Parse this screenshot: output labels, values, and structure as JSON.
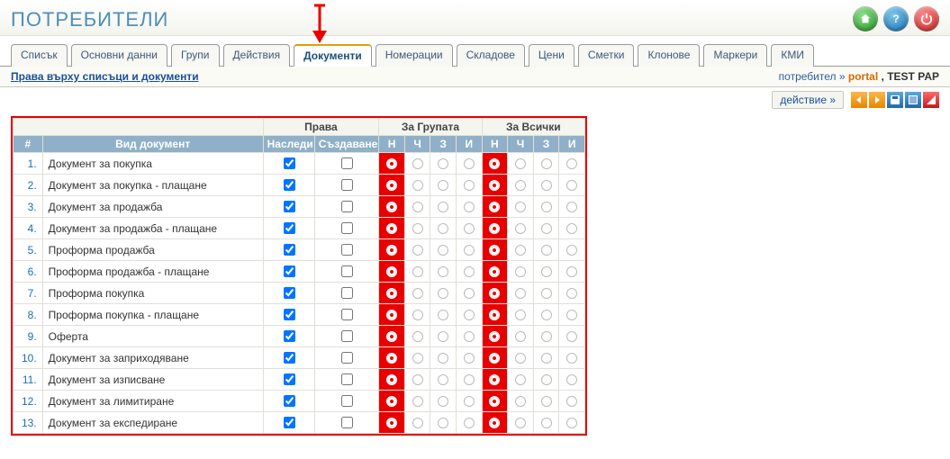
{
  "page_title": "ПОТРЕБИТЕЛИ",
  "tabs": [
    {
      "label": "Списък",
      "active": false
    },
    {
      "label": "Основни данни",
      "active": false
    },
    {
      "label": "Групи",
      "active": false
    },
    {
      "label": "Действия",
      "active": false
    },
    {
      "label": "Документи",
      "active": true
    },
    {
      "label": "Номерации",
      "active": false
    },
    {
      "label": "Складове",
      "active": false
    },
    {
      "label": "Цени",
      "active": false
    },
    {
      "label": "Сметки",
      "active": false
    },
    {
      "label": "Клонове",
      "active": false
    },
    {
      "label": "Маркери",
      "active": false
    },
    {
      "label": "КМИ",
      "active": false
    }
  ],
  "sub_header": "Права върху списъци и документи",
  "user_label": "потребител »",
  "user_name": "portal",
  "user_context": ", TEST PAP",
  "action_link": "действие  »",
  "columns": {
    "idx": "#",
    "docname": "Вид документ",
    "rights_group_header": "Права",
    "group_header": "За Групата",
    "all_header": "За Всички",
    "inherit": "Наследи",
    "create": "Създаване",
    "r1": "Н",
    "r2": "Ч",
    "r3": "З",
    "r4": "И"
  },
  "rows": [
    {
      "n": "1.",
      "name": "Документ за покупка",
      "inherit": true,
      "create": false,
      "grp": 0,
      "all": 0
    },
    {
      "n": "2.",
      "name": "Документ за покупка - плащане",
      "inherit": true,
      "create": false,
      "grp": 0,
      "all": 0
    },
    {
      "n": "3.",
      "name": "Документ за продажба",
      "inherit": true,
      "create": false,
      "grp": 0,
      "all": 0
    },
    {
      "n": "4.",
      "name": "Документ за продажба - плащане",
      "inherit": true,
      "create": false,
      "grp": 0,
      "all": 0
    },
    {
      "n": "5.",
      "name": "Проформа продажба",
      "inherit": true,
      "create": false,
      "grp": 0,
      "all": 0
    },
    {
      "n": "6.",
      "name": "Проформа продажба - плащане",
      "inherit": true,
      "create": false,
      "grp": 0,
      "all": 0
    },
    {
      "n": "7.",
      "name": "Проформа покупка",
      "inherit": true,
      "create": false,
      "grp": 0,
      "all": 0
    },
    {
      "n": "8.",
      "name": "Проформа покупка - плащане",
      "inherit": true,
      "create": false,
      "grp": 0,
      "all": 0
    },
    {
      "n": "9.",
      "name": "Оферта",
      "inherit": true,
      "create": false,
      "grp": 0,
      "all": 0
    },
    {
      "n": "10.",
      "name": "Документ за заприходяване",
      "inherit": true,
      "create": false,
      "grp": 0,
      "all": 0
    },
    {
      "n": "11.",
      "name": "Документ за изписване",
      "inherit": true,
      "create": false,
      "grp": 0,
      "all": 0
    },
    {
      "n": "12.",
      "name": "Документ за лимитиране",
      "inherit": true,
      "create": false,
      "grp": 0,
      "all": 0
    },
    {
      "n": "13.",
      "name": "Документ за експедиране",
      "inherit": true,
      "create": false,
      "grp": 0,
      "all": 0
    }
  ]
}
